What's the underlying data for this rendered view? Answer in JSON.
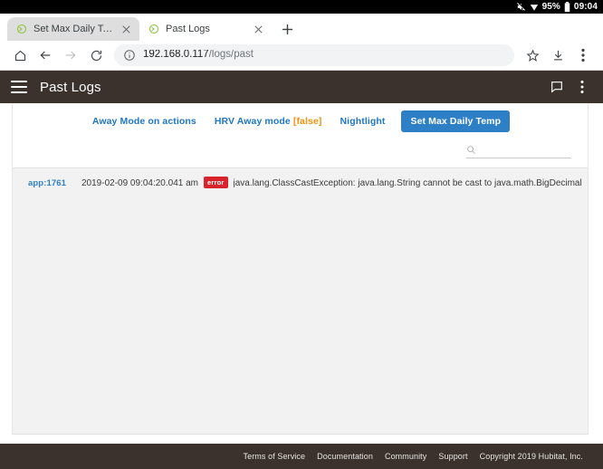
{
  "status_bar": {
    "mute_icon": "mute-icon",
    "signal_icon": "wifi-signal-icon",
    "battery_percent": "95%",
    "battery_icon": "battery-icon",
    "clock": "09:04"
  },
  "browser": {
    "tabs": [
      {
        "title": "Set Max Daily Temp",
        "favicon": "hubitat-favicon",
        "active": false
      },
      {
        "title": "Past Logs",
        "favicon": "hubitat-favicon",
        "active": true
      }
    ],
    "new_tab_label": "+",
    "toolbar": {
      "home_icon": "home-icon",
      "back_icon": "back-arrow-icon",
      "forward_icon": "forward-arrow-icon",
      "reload_icon": "reload-icon",
      "info_icon": "site-info-icon",
      "url_host": "192.168.0.117",
      "url_path": "/logs/past",
      "bookmark_icon": "star-icon",
      "download_icon": "download-icon",
      "menu_icon": "kebab-menu-icon"
    }
  },
  "app_header": {
    "menu_icon": "hamburger-menu-icon",
    "title": "Past Logs",
    "chat_icon": "chat-bubble-icon",
    "overflow_icon": "kebab-menu-icon"
  },
  "filters": [
    {
      "label": "Away Mode on actions",
      "flag": "",
      "active": false
    },
    {
      "label": "HRV Away mode",
      "flag": "[false]",
      "active": false
    },
    {
      "label": "Nightlight",
      "flag": "",
      "active": false
    },
    {
      "label": "Set Max Daily Temp",
      "flag": "",
      "active": true
    }
  ],
  "search": {
    "icon": "search-icon",
    "value": "",
    "placeholder": ""
  },
  "log_table": {
    "rows": [
      {
        "source": "app:1761",
        "timestamp": "2019-02-09 09:04:20.041 am",
        "level": "error",
        "message": "java.lang.ClassCastException: java.lang.String cannot be cast to java.math.BigDecimal (selectCTrig)"
      }
    ]
  },
  "footer": {
    "links": [
      "Terms of Service",
      "Documentation",
      "Community",
      "Support"
    ],
    "copyright": "Copyright 2019 Hubitat, Inc."
  },
  "colors": {
    "accent_blue": "#2d80c6",
    "link_blue": "#1f77c4",
    "flag_orange": "#f0920e",
    "error_red": "#d9232a",
    "header_brown": "#3b322e"
  }
}
